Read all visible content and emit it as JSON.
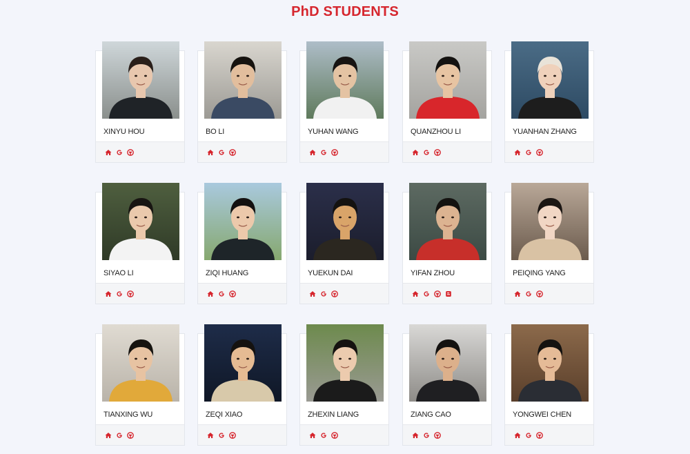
{
  "section": {
    "title": "PhD STUDENTS"
  },
  "colors": {
    "accent": "#d6262e",
    "background": "#f3f5fb",
    "card": "#ffffff"
  },
  "students": [
    {
      "name": "XINYU HOU",
      "links": [
        "home-icon",
        "google-scholar-icon",
        "github-icon"
      ],
      "photo": {
        "bg1": "#cfd7da",
        "bg2": "#8a8f8c",
        "skin": "#e8c7ae",
        "hair": "#2a1f1a",
        "shirt": "#1f2327"
      }
    },
    {
      "name": "BO LI",
      "links": [
        "home-icon",
        "google-scholar-icon",
        "github-icon"
      ],
      "photo": {
        "bg1": "#d9d6cf",
        "bg2": "#9c9a94",
        "skin": "#e2be9d",
        "hair": "#16130f",
        "shirt": "#3a4a63"
      }
    },
    {
      "name": "YUHAN WANG",
      "links": [
        "home-icon",
        "google-scholar-icon",
        "github-icon"
      ],
      "photo": {
        "bg1": "#aebdc8",
        "bg2": "#5f7a5c",
        "skin": "#e4c3a3",
        "hair": "#171412",
        "shirt": "#f1f1f1"
      }
    },
    {
      "name": "QUANZHOU LI",
      "links": [
        "home-icon",
        "google-scholar-icon",
        "github-icon"
      ],
      "photo": {
        "bg1": "#c9c9c6",
        "bg2": "#a4a39f",
        "skin": "#e7c4a2",
        "hair": "#141210",
        "shirt": "#d8262b"
      }
    },
    {
      "name": "YUANHAN ZHANG",
      "links": [
        "home-icon",
        "google-scholar-icon",
        "github-icon"
      ],
      "photo": {
        "bg1": "#4b6c86",
        "bg2": "#2d4a63",
        "skin": "#efd1bb",
        "hair": "#e9e3d8",
        "shirt": "#1d1d1d"
      }
    },
    {
      "name": "SIYAO LI",
      "links": [
        "home-icon",
        "google-scholar-icon",
        "github-icon"
      ],
      "photo": {
        "bg1": "#4f5f3f",
        "bg2": "#2f3a27",
        "skin": "#eac9ac",
        "hair": "#181512",
        "shirt": "#f3f3f3"
      }
    },
    {
      "name": "ZIQI HUANG",
      "links": [
        "home-icon",
        "google-scholar-icon",
        "github-icon"
      ],
      "photo": {
        "bg1": "#a9c9de",
        "bg2": "#86a86f",
        "skin": "#ecc9ab",
        "hair": "#141110",
        "shirt": "#1e2529"
      }
    },
    {
      "name": "YUEKUN DAI",
      "links": [
        "home-icon",
        "google-scholar-icon",
        "github-icon"
      ],
      "photo": {
        "bg1": "#2b2f4a",
        "bg2": "#1b1d2c",
        "skin": "#d9a469",
        "hair": "#141210",
        "shirt": "#2b2720"
      }
    },
    {
      "name": "YIFAN ZHOU",
      "links": [
        "home-icon",
        "google-scholar-icon",
        "github-icon",
        "blog-icon"
      ],
      "photo": {
        "bg1": "#5d6a62",
        "bg2": "#3c4a44",
        "skin": "#dcb391",
        "hair": "#141210",
        "shirt": "#c72f2a"
      }
    },
    {
      "name": "PEIQING YANG",
      "links": [
        "home-icon",
        "google-scholar-icon",
        "github-icon"
      ],
      "photo": {
        "bg1": "#b9a898",
        "bg2": "#6b5b4d",
        "skin": "#f1d6c4",
        "hair": "#1b1613",
        "shirt": "#d9c2a4"
      }
    },
    {
      "name": "TIANXING WU",
      "links": [
        "home-icon",
        "google-scholar-icon",
        "github-icon"
      ],
      "photo": {
        "bg1": "#e0dbd2",
        "bg2": "#b9b3a9",
        "skin": "#e7c3a2",
        "hair": "#16130f",
        "shirt": "#e1a93a"
      }
    },
    {
      "name": "ZEQI XIAO",
      "links": [
        "home-icon",
        "google-scholar-icon",
        "github-icon"
      ],
      "photo": {
        "bg1": "#1e2c49",
        "bg2": "#0f1726",
        "skin": "#e5bb93",
        "hair": "#151210",
        "shirt": "#d8c9aa"
      }
    },
    {
      "name": "ZHEXIN LIANG",
      "links": [
        "home-icon",
        "google-scholar-icon",
        "github-icon"
      ],
      "photo": {
        "bg1": "#6d8a4d",
        "bg2": "#9a9a93",
        "skin": "#eccbae",
        "hair": "#151210",
        "shirt": "#1b1b1b"
      }
    },
    {
      "name": "ZIANG CAO",
      "links": [
        "home-icon",
        "google-scholar-icon",
        "github-icon"
      ],
      "photo": {
        "bg1": "#d9d8d6",
        "bg2": "#8e8c88",
        "skin": "#dcb08b",
        "hair": "#141210",
        "shirt": "#1f1f22"
      }
    },
    {
      "name": "YONGWEI CHEN",
      "links": [
        "home-icon",
        "google-scholar-icon",
        "github-icon"
      ],
      "photo": {
        "bg1": "#8c6a4b",
        "bg2": "#5a3f2b",
        "skin": "#e5bb97",
        "hair": "#141210",
        "shirt": "#2a2d34"
      }
    }
  ]
}
